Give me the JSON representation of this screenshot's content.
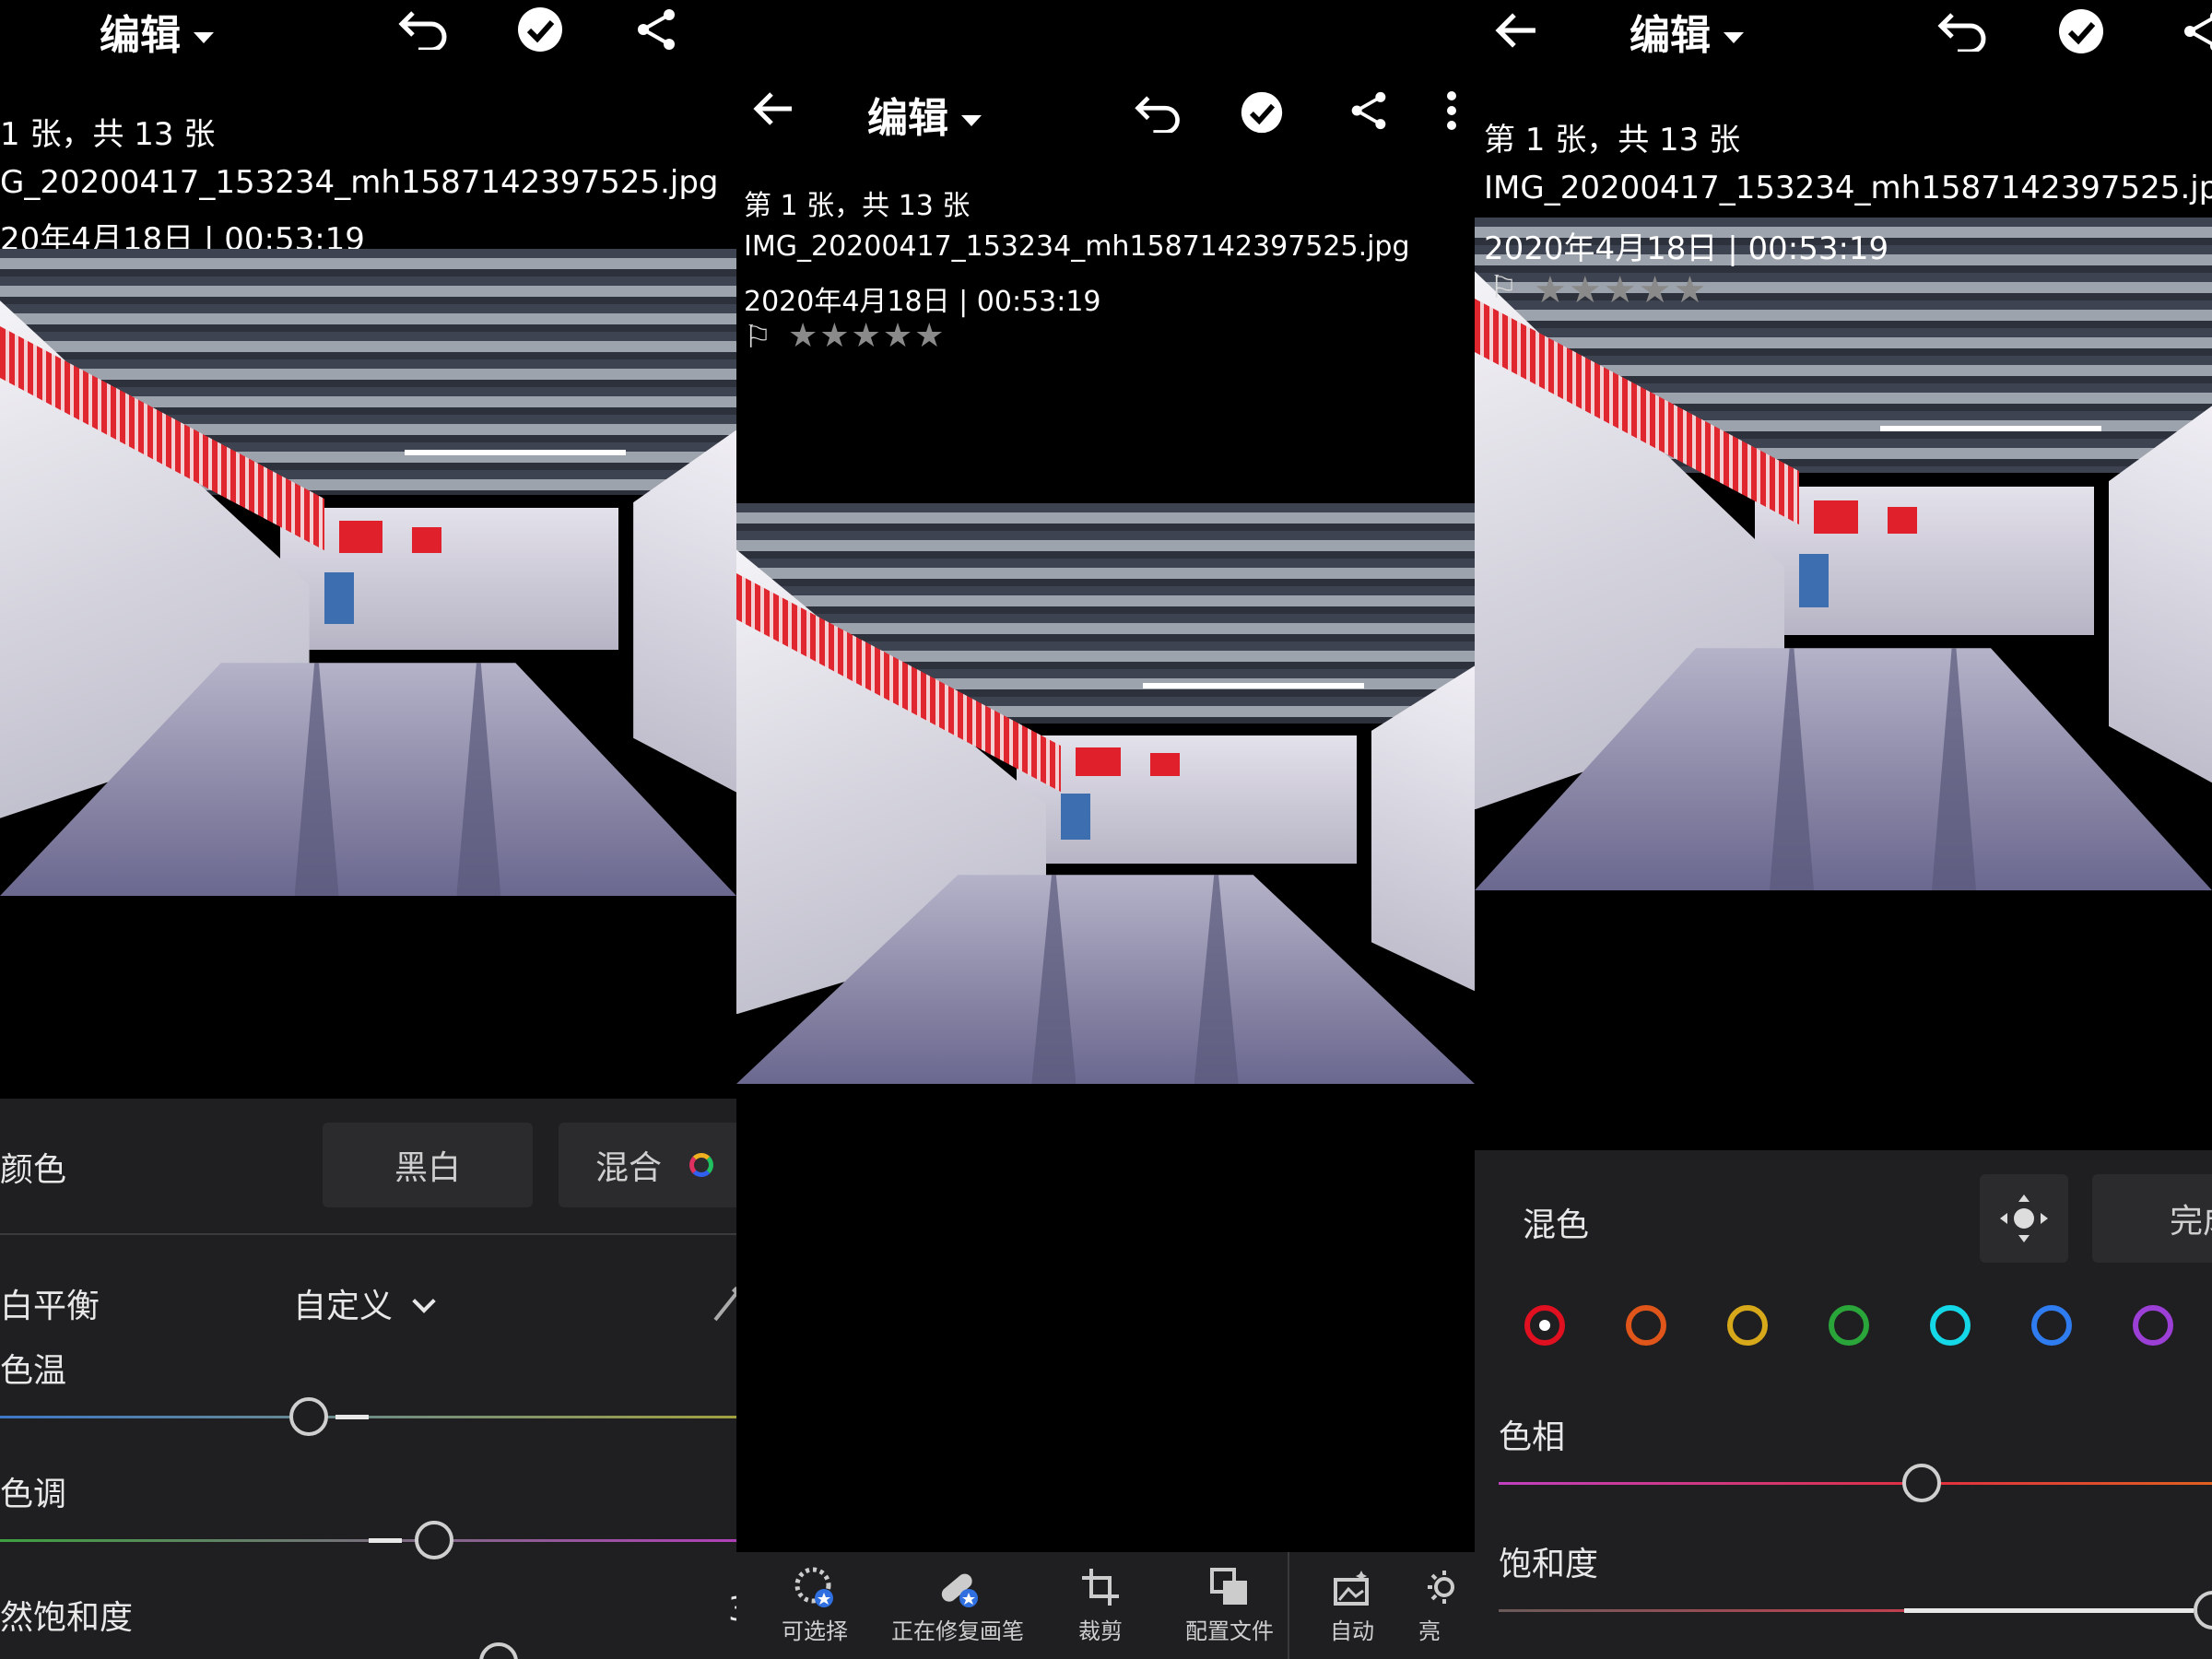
{
  "panel1": {
    "title": "编辑",
    "counter": "1 张，共 13 张",
    "filename": "G_20200417_153234_mh1587142397525.jpg",
    "datetime": "20年4月18日 | 00:53:19",
    "stars": "★★★★★",
    "section_label": "颜色",
    "bw_chip": "黑白",
    "mix_chip": "混合",
    "wb_label": "白平衡",
    "wb_value": "自定义",
    "temp_label": "色温",
    "temp_value": "",
    "tint_label": "色调",
    "vib_label": "然饱和度",
    "vib_value": "3"
  },
  "panel2": {
    "title": "编辑",
    "counter": "第 1 张，共 13 张",
    "filename": "IMG_20200417_153234_mh1587142397525.jpg",
    "datetime": "2020年4月18日 | 00:53:19",
    "flag": "⚐",
    "stars": "★★★★★",
    "tools": [
      {
        "label": "可选择",
        "icon": "selective-icon"
      },
      {
        "label": "正在修复画笔",
        "icon": "healing-brush-icon"
      },
      {
        "label": "裁剪",
        "icon": "crop-icon"
      },
      {
        "label": "配置文件",
        "icon": "profiles-icon"
      },
      {
        "label": "自动",
        "icon": "auto-icon"
      },
      {
        "label": "亮",
        "icon": "light-icon"
      }
    ]
  },
  "panel3": {
    "title": "编辑",
    "counter": "第 1 张，共 13 张",
    "filename": "IMG_20200417_153234_mh1587142397525.jpg",
    "datetime": "2020年4月18日 | 00:53:19",
    "flag": "⚐",
    "stars": "★★★★★",
    "mix_label": "混色",
    "done_label": "完成",
    "hue_label": "色相",
    "sat_label": "饱和度",
    "colors": [
      "#e01020",
      "#e0551a",
      "#d6a81a",
      "#2aa53a",
      "#14d8e8",
      "#2f7bf0",
      "#9b3fd6"
    ]
  }
}
